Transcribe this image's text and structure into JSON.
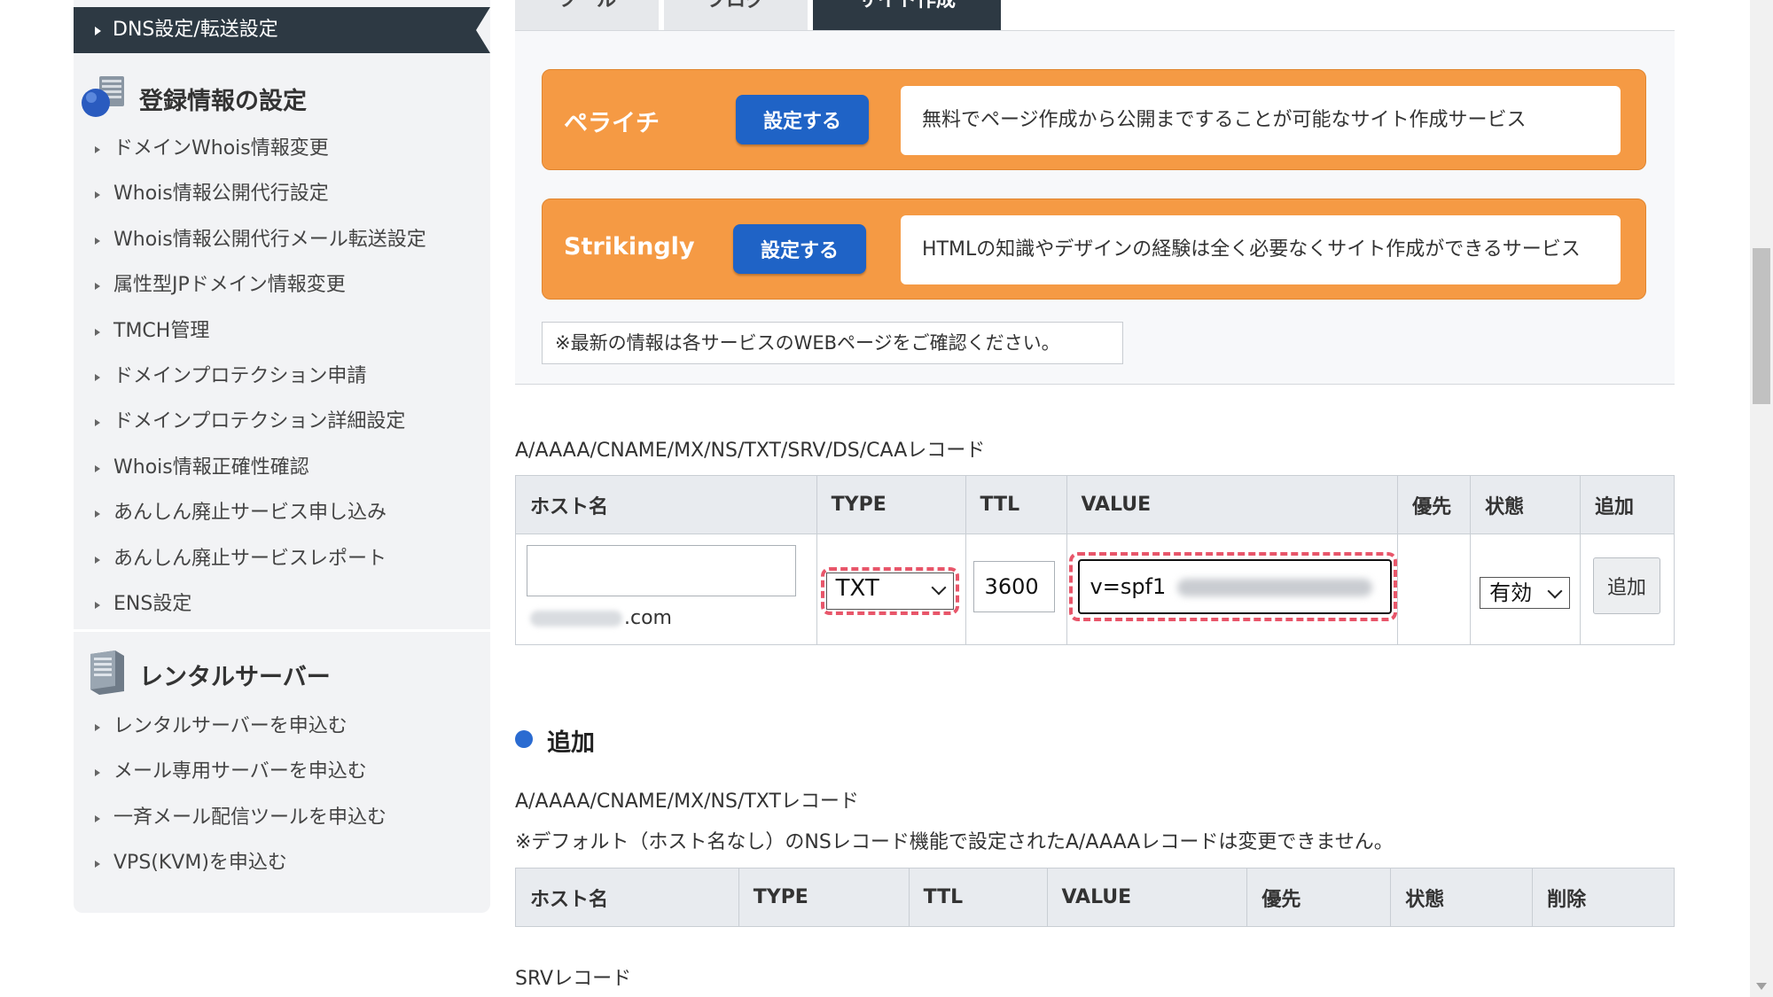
{
  "sidebar": {
    "active_item": "DNS設定/転送設定",
    "sections": [
      {
        "title": "登録情報の設定",
        "icon": "database-icon",
        "items": [
          "ドメインWhois情報変更",
          "Whois情報公開代行設定",
          "Whois情報公開代行メール転送設定",
          "属性型JPドメイン情報変更",
          "TMCH管理",
          "ドメインプロテクション申請",
          "ドメインプロテクション詳細設定",
          "Whois情報正確性確認",
          "あんしん廃止サービス申し込み",
          "あんしん廃止サービスレポート",
          "ENS設定"
        ]
      },
      {
        "title": "レンタルサーバー",
        "icon": "server-icon",
        "items": [
          "レンタルサーバーを申込む",
          "メール専用サーバーを申込む",
          "一斉メール配信ツールを申込む",
          "VPS(KVM)を申込む"
        ]
      }
    ]
  },
  "tabs": [
    {
      "label": "ツール",
      "active": false
    },
    {
      "label": "ブログ",
      "active": false
    },
    {
      "label": "サイト作成",
      "active": true
    }
  ],
  "promos": [
    {
      "name": "ペライチ",
      "button": "設定する",
      "description": "無料でページ作成から公開まですることが可能なサイト作成サービス"
    },
    {
      "name": "Strikingly",
      "button": "設定する",
      "description": "HTMLの知識やデザインの経験は全く必要なくサイト作成ができるサービス"
    }
  ],
  "promo_note": "※最新の情報は各サービスのWEBページをご確認ください。",
  "record_form": {
    "label": "A/AAAA/CNAME/MX/NS/TXT/SRV/DS/CAAレコード",
    "headers": [
      "ホスト名",
      "TYPE",
      "TTL",
      "VALUE",
      "優先",
      "状態",
      "追加"
    ],
    "host_value": "",
    "domain_suffix": ".com",
    "type_value": "TXT",
    "ttl_value": "3600",
    "value_value": "v=spf1",
    "status_value": "有効",
    "add_button": "追加"
  },
  "add_section": {
    "title": "追加",
    "label": "A/AAAA/CNAME/MX/NS/TXTレコード",
    "note": "※デフォルト（ホスト名なし）のNSレコード機能で設定されたA/AAAAレコードは変更できません。",
    "headers": [
      "ホスト名",
      "TYPE",
      "TTL",
      "VALUE",
      "優先",
      "状態",
      "削除"
    ]
  },
  "srv_label": "SRVレコード",
  "colors": {
    "sidebar_active_bg": "#2d3943",
    "promo_orange": "#f59a44",
    "button_blue": "#1f63c6",
    "highlight_dash": "#e8566a",
    "bullet_blue": "#2a6bd1"
  }
}
